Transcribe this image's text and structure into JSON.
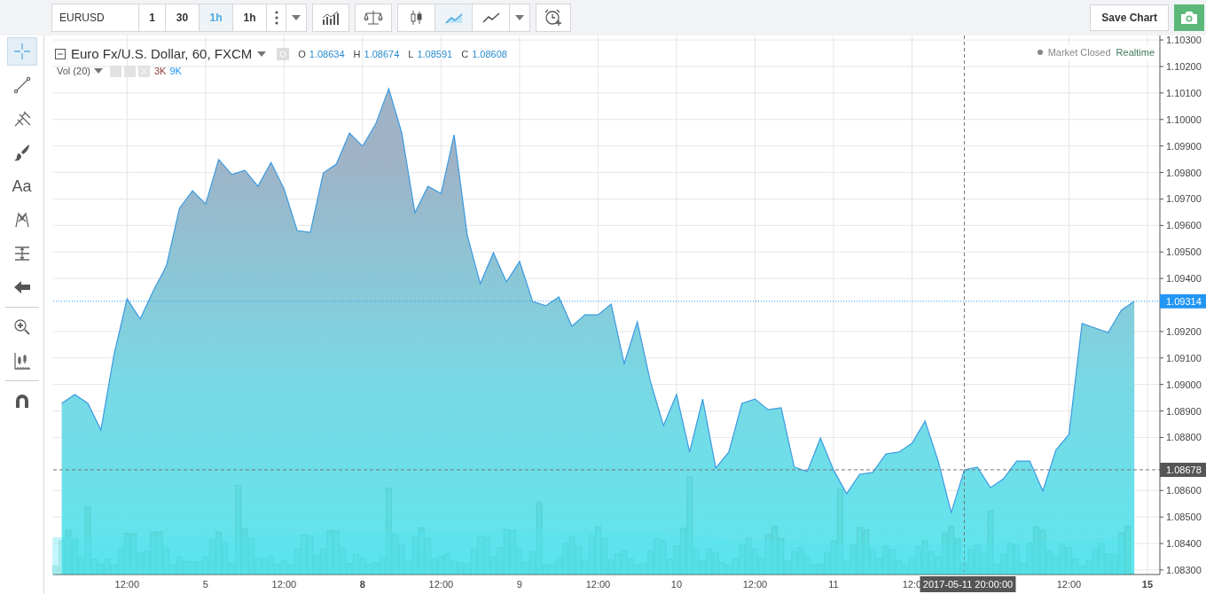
{
  "toolbar": {
    "symbol": "EURUSD",
    "intervals": [
      {
        "label": "1",
        "selected": false
      },
      {
        "label": "30",
        "selected": false
      },
      {
        "label": "1h",
        "selected": true
      },
      {
        "label": "1h",
        "selected": false
      }
    ],
    "chart_styles": [
      {
        "kind": "candles",
        "selected": false
      },
      {
        "kind": "area",
        "selected": true
      },
      {
        "kind": "line",
        "selected": false
      }
    ],
    "save_button": "Save Chart"
  },
  "drawing_tools": [
    {
      "kind": "crosshair",
      "selected": true
    },
    {
      "kind": "trendline",
      "selected": false
    },
    {
      "kind": "pitchfork",
      "selected": false
    },
    {
      "kind": "brush",
      "selected": false
    },
    {
      "kind": "text",
      "label": "Aa",
      "selected": false
    },
    {
      "kind": "pattern",
      "selected": false
    },
    {
      "kind": "measure",
      "selected": false
    },
    {
      "kind": "arrow",
      "selected": false
    },
    {
      "kind": "separator"
    },
    {
      "kind": "zoom",
      "selected": false
    },
    {
      "kind": "ruler",
      "selected": false
    },
    {
      "kind": "separator"
    },
    {
      "kind": "magnet",
      "selected": false
    }
  ],
  "legend": {
    "title": "Euro Fx/U.S. Dollar, 60, FXCM",
    "ohlc": [
      {
        "key": "O",
        "value": "1.08634"
      },
      {
        "key": "H",
        "value": "1.08674"
      },
      {
        "key": "L",
        "value": "1.08591"
      },
      {
        "key": "C",
        "value": "1.08608"
      }
    ],
    "volume": {
      "label": "Vol (20)",
      "values": [
        {
          "text": "3K",
          "color": "#8b3a3a"
        },
        {
          "text": "9K",
          "color": "#2196f3"
        }
      ]
    },
    "status": "Market Closed",
    "feed": "Realtime"
  },
  "chart": {
    "chart_data": {
      "type": "area",
      "ylim": [
        1.08283,
        1.10317
      ],
      "grid": true,
      "categories": [
        null,
        null,
        null,
        null,
        null,
        "12:00",
        null,
        null,
        null,
        null,
        null,
        "5",
        null,
        null,
        null,
        null,
        null,
        "12:00",
        null,
        null,
        null,
        null,
        null,
        "8",
        null,
        null,
        null,
        null,
        null,
        "12:00",
        null,
        null,
        null,
        null,
        null,
        "9",
        null,
        null,
        null,
        null,
        null,
        "12:00",
        null,
        null,
        null,
        null,
        null,
        "10",
        null,
        null,
        null,
        null,
        null,
        "12:00",
        null,
        null,
        null,
        null,
        null,
        "11",
        null,
        null,
        null,
        null,
        null,
        "12:0",
        null,
        null,
        null,
        null,
        null,
        null,
        null,
        null,
        null,
        null,
        null,
        "12:00",
        null,
        null,
        null,
        null,
        null,
        "15"
      ],
      "series": [
        {
          "color": "#3b9ae1",
          "values": [
            1.08929,
            1.08962,
            1.08929,
            1.08828,
            1.09113,
            1.09323,
            1.09247,
            1.09354,
            1.09447,
            1.09665,
            1.09731,
            1.09681,
            1.09849,
            1.09792,
            1.09808,
            1.09748,
            1.09838,
            1.09738,
            1.09581,
            1.09574,
            1.09798,
            1.09832,
            1.09949,
            1.09899,
            1.09982,
            1.10116,
            1.09949,
            1.09648,
            1.09748,
            1.09721,
            1.09942,
            1.09564,
            1.0938,
            1.09497,
            1.09387,
            1.09464,
            1.09313,
            1.09297,
            1.0933,
            1.0922,
            1.09263,
            1.09263,
            1.09303,
            1.09079,
            1.09236,
            1.09012,
            1.08845,
            1.08962,
            1.08745,
            1.08945,
            1.08685,
            1.08745,
            1.08929,
            1.08945,
            1.08905,
            1.08912,
            1.08688,
            1.08671,
            1.08798,
            1.08678,
            1.08588,
            1.08661,
            1.08668,
            1.08738,
            1.08745,
            1.08778,
            1.08862,
            1.08711,
            1.08517,
            1.08678,
            1.08688,
            1.08611,
            1.08644,
            1.08711,
            1.08711,
            1.08598,
            1.08752,
            1.08812,
            1.0923,
            1.09213,
            1.09196,
            1.0928,
            1.09314,
            null
          ]
        }
      ],
      "yticks": [
        {
          "value": 1.083,
          "label": "1.08300"
        },
        {
          "value": 1.084,
          "label": "1.08400"
        },
        {
          "value": 1.085,
          "label": "1.08500"
        },
        {
          "value": 1.086,
          "label": "1.08600"
        },
        {
          "value": 1.088,
          "label": "1.08800"
        },
        {
          "value": 1.089,
          "label": "1.08900"
        },
        {
          "value": 1.09,
          "label": "1.09000"
        },
        {
          "value": 1.091,
          "label": "1.09100"
        },
        {
          "value": 1.092,
          "label": "1.09200"
        },
        {
          "value": 1.094,
          "label": "1.09400"
        },
        {
          "value": 1.095,
          "label": "1.09500"
        },
        {
          "value": 1.096,
          "label": "1.09600"
        },
        {
          "value": 1.097,
          "label": "1.09700"
        },
        {
          "value": 1.098,
          "label": "1.09800"
        },
        {
          "value": 1.099,
          "label": "1.09900"
        },
        {
          "value": 1.1,
          "label": "1.10000"
        },
        {
          "value": 1.101,
          "label": "1.10100"
        },
        {
          "value": 1.102,
          "label": "1.10200"
        },
        {
          "value": 1.103,
          "label": "1.10300"
        }
      ],
      "ref_lines": [
        {
          "axis": "y",
          "value": 1.09314,
          "label": "1.09314"
        },
        {
          "axis": "y",
          "value": 1.08678,
          "label": "1.08678"
        }
      ],
      "annotations": [
        "2017-05-11 20:00:00"
      ]
    }
  }
}
